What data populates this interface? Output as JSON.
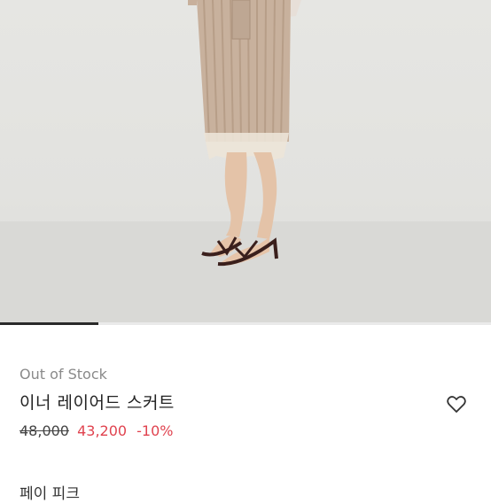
{
  "product": {
    "stock_status": "Out of Stock",
    "name": "이너 레이어드 스커트",
    "original_price": "48,000",
    "sale_price": "43,200",
    "discount": "-10%"
  },
  "gallery": {
    "progress_fraction": 0.2
  },
  "next_section_label": "페이 피크",
  "icons": {
    "favorite": "heart-outline-icon"
  },
  "colors": {
    "sale": "#e0434f",
    "strike": "#444444",
    "muted": "#8a8a8a"
  }
}
